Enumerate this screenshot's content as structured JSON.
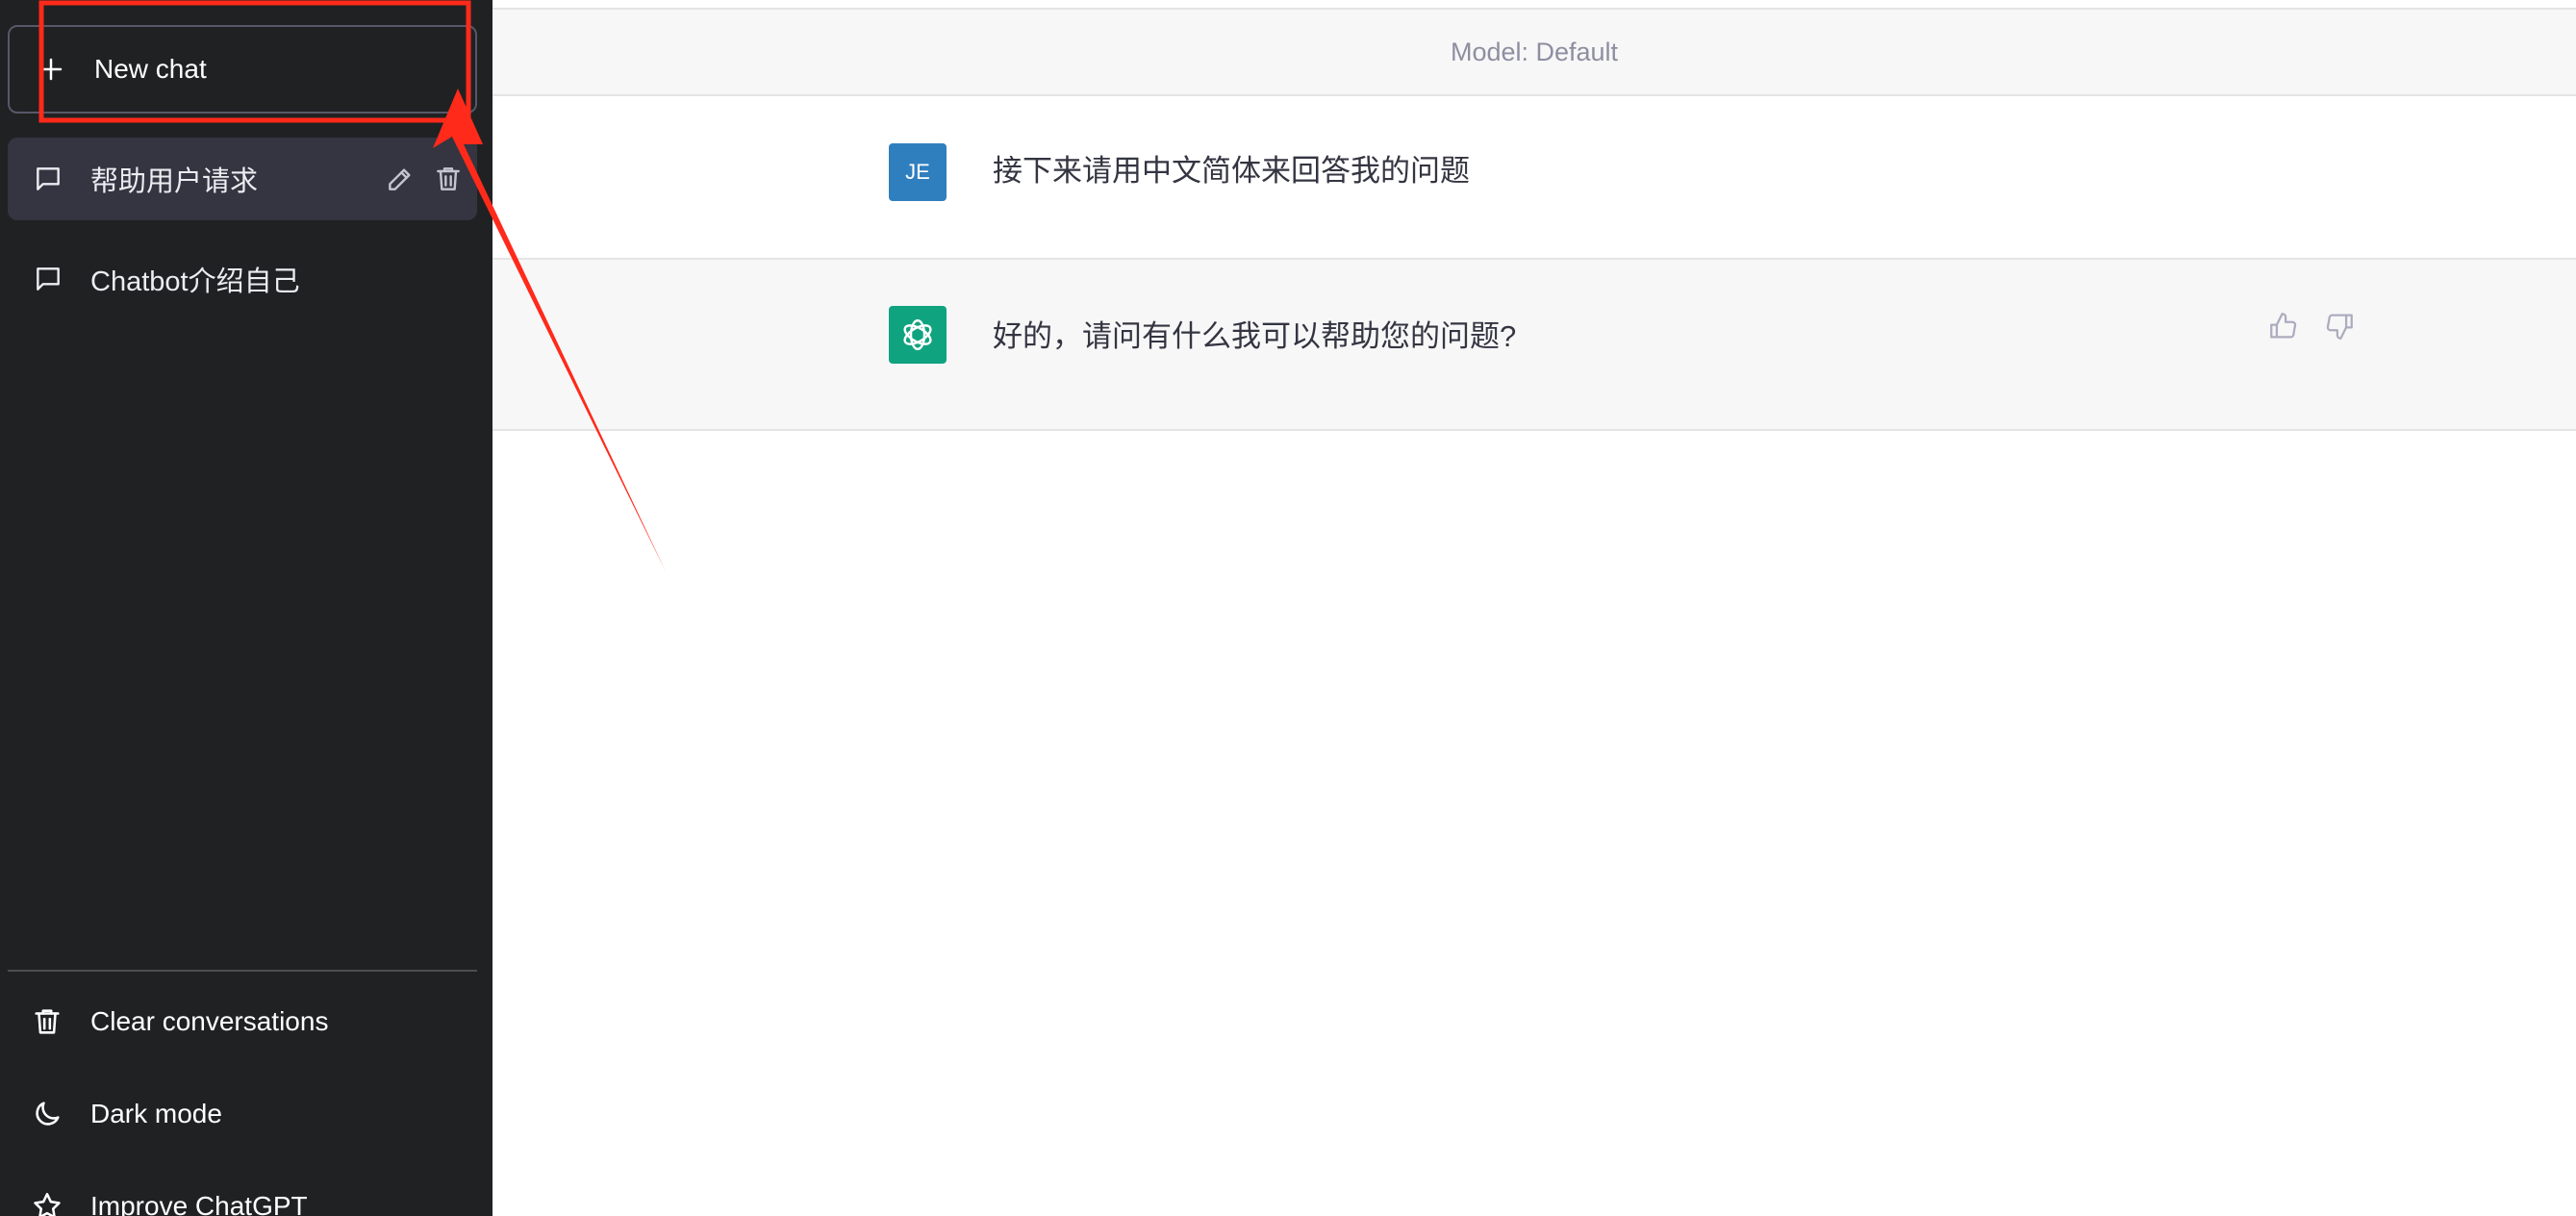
{
  "sidebar": {
    "new_chat_label": "New chat",
    "conversations": [
      {
        "title": "帮助用户请求",
        "active": true
      },
      {
        "title": "Chatbot介绍自己",
        "active": false
      }
    ],
    "bottom_items": [
      {
        "label": "Clear conversations",
        "icon": "trash-icon"
      },
      {
        "label": "Dark mode",
        "icon": "moon-icon"
      },
      {
        "label": "Improve ChatGPT",
        "icon": "star-icon"
      }
    ]
  },
  "main": {
    "model_label": "Model: Default",
    "messages": [
      {
        "role": "user",
        "avatar_text": "JE",
        "text": "接下来请用中文简体来回答我的问题"
      },
      {
        "role": "assistant",
        "avatar_icon": "openai-logo-icon",
        "text": "好的，请问有什么我可以帮助您的问题?"
      }
    ]
  },
  "colors": {
    "sidebar_bg": "#202123",
    "active_item_bg": "#343541",
    "user_avatar": "#2f7fbf",
    "assistant_avatar": "#10a37f",
    "annotation_red": "#ff2a1a"
  }
}
